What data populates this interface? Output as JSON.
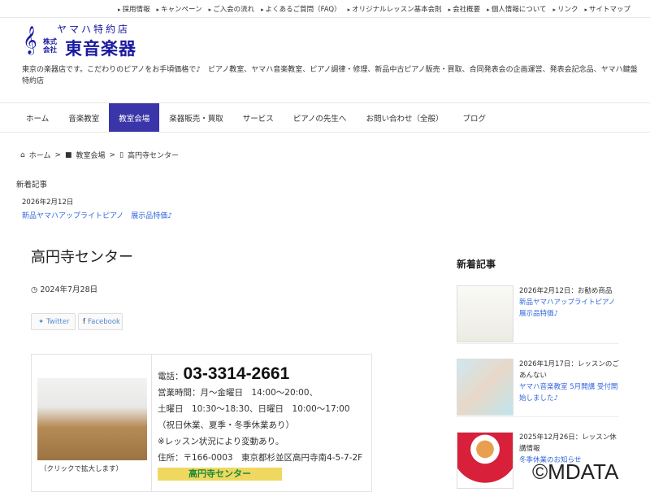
{
  "top_links": [
    "採用情報",
    "キャンペーン",
    "ご入会の流れ",
    "よくあるご質問（FAQ）",
    "オリジナルレッスン基本会則",
    "会社概要",
    "個人情報について",
    "リンク",
    "サイトマップ"
  ],
  "logo": {
    "line1": "ヤマハ特約店",
    "kabushiki": "株式会社",
    "name": "東音楽器"
  },
  "description": "東京の楽器店です。こだわりのピアノをお手頃価格で♪　ピアノ教室、ヤマハ音楽教室、ピアノ調律・修理、新品中古ピアノ販売・買取、合同発表会の企画運営、発表会記念品、ヤマハ鍵盤特約店",
  "nav": [
    "ホーム",
    "音楽教室",
    "教室会場",
    "楽器販売・買取",
    "サービス",
    "ピアノの先生へ",
    "お問い合わせ（全般）",
    "ブログ"
  ],
  "breadcrumb": [
    "ホーム",
    "教室会場",
    "高円寺センター"
  ],
  "news_top": {
    "heading": "新着記事",
    "date": "2026年2月12日",
    "link": "新品ヤマハアップライトピアノ　展示品特価♪"
  },
  "post": {
    "title": "高円寺センター",
    "date": "2024年7月28日",
    "twitter": "Twitter",
    "facebook": "Facebook"
  },
  "info": {
    "caption": "（クリックで拡大します）",
    "phone_label": "電話：",
    "phone": "03-3314-2661",
    "lines": [
      "営業時間：月～金曜日　14:00～20:00、",
      "土曜日　10:30～18:30、日曜日　10:00～17:00",
      "（祝日休業、夏季・冬季休業あり）",
      "※レッスン状況により変動あり。",
      "住所：〒166-0003　東京都杉並区高円寺南4-5-7-2F"
    ],
    "banner": "高円寺センター"
  },
  "sidebar": {
    "heading": "新着記事",
    "items": [
      {
        "meta": "2026年2月12日：お勧め商品",
        "title": "新品ヤマハアップライトピアノ 展示品特価♪"
      },
      {
        "meta": "2026年1月17日：レッスンのごあんない",
        "title": "ヤマハ音楽教室 5月開講 受付開始しました♪"
      },
      {
        "meta": "2025年12月26日：レッスン休講情報",
        "title": "冬季休業のお知らせ"
      }
    ]
  },
  "watermark": "©MDATA",
  "colors": {
    "accent": "#3a35a8",
    "link": "#3366dd"
  }
}
